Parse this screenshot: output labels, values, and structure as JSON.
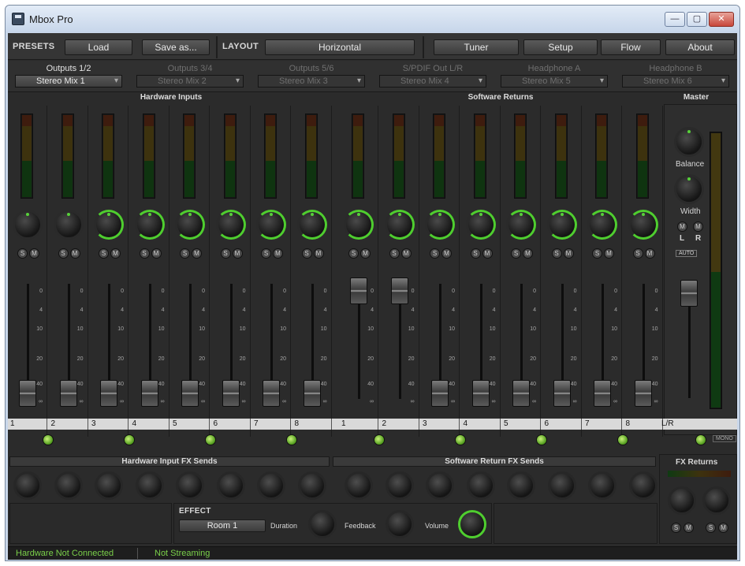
{
  "window": {
    "title": "Mbox Pro",
    "min_label": "—",
    "max_label": "▢",
    "close_label": "✕"
  },
  "toolbar": {
    "presets_label": "PRESETS",
    "load_label": "Load",
    "save_as_label": "Save as...",
    "layout_label": "LAYOUT",
    "layout_value": "Horizontal",
    "tuner_label": "Tuner",
    "setup_label": "Setup",
    "flow_label": "Flow",
    "about_label": "About"
  },
  "outputs": [
    {
      "label": "Outputs 1/2",
      "value": "Stereo Mix 1"
    },
    {
      "label": "Outputs 3/4",
      "value": "Stereo Mix 2"
    },
    {
      "label": "Outputs 5/6",
      "value": "Stereo Mix 3"
    },
    {
      "label": "S/PDIF Out L/R",
      "value": "Stereo Mix 4"
    },
    {
      "label": "Headphone A",
      "value": "Stereo Mix 5"
    },
    {
      "label": "Headphone B",
      "value": "Stereo Mix 6"
    }
  ],
  "sections": {
    "hardware_inputs": "Hardware Inputs",
    "software_returns": "Software Returns",
    "master": "Master"
  },
  "channel_strip": {
    "mute": "M",
    "solo": "S"
  },
  "fader_scale": [
    "0",
    "4",
    "10",
    "20",
    "40",
    "∞"
  ],
  "channels": {
    "hardware": [
      "1",
      "2",
      "3",
      "4",
      "5",
      "6",
      "7",
      "8"
    ],
    "software": [
      "1",
      "2",
      "3",
      "4",
      "5",
      "6",
      "7",
      "8"
    ],
    "master": "L/R"
  },
  "master": {
    "balance_label": "Balance",
    "width_label": "Width",
    "left_label": "L",
    "right_label": "R",
    "auto_label": "AUTO",
    "mono_label": "MONO"
  },
  "fx_sends": {
    "hardware_label": "Hardware Input FX Sends",
    "software_label": "Software Return FX Sends",
    "returns_label": "FX Returns"
  },
  "effect": {
    "label": "EFFECT",
    "preset": "Room 1",
    "duration_label": "Duration",
    "feedback_label": "Feedback",
    "volume_label": "Volume"
  },
  "status": {
    "hardware": "Hardware Not Connected",
    "streaming": "Not Streaming"
  },
  "colors": {
    "accent": "#4fce2f",
    "background": "#2b2b2b"
  }
}
